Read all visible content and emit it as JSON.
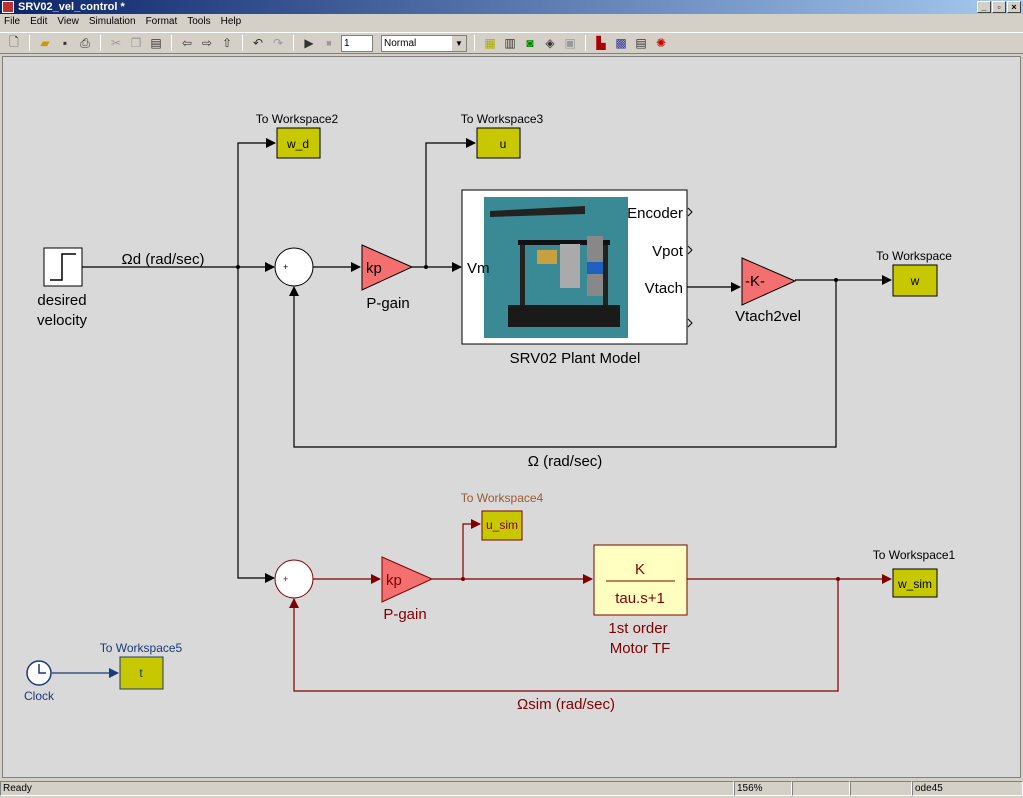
{
  "window": {
    "title": "SRV02_vel_control *",
    "min": "_",
    "max": "▫",
    "close": "×"
  },
  "menu": [
    "File",
    "Edit",
    "View",
    "Simulation",
    "Format",
    "Tools",
    "Help"
  ],
  "toolbar": {
    "stop_time": "1",
    "sim_mode": "Normal"
  },
  "status": {
    "left": "Ready",
    "zoom": "156%",
    "blank1": "",
    "blank2": "",
    "solver": "ode45"
  },
  "colors": {
    "canvas": "#d9d9d9",
    "gain": "#f47070",
    "workspace": "#c8c800",
    "sim_signal": "#800000",
    "clock": "#1a3a7a"
  },
  "diagram": {
    "step": {
      "label1": "desired",
      "label2": "velocity"
    },
    "ref_signal": "Ωd (rad/sec)",
    "gain1": {
      "value": "kp",
      "label": "P-gain"
    },
    "plant": {
      "label": "SRV02 Plant Model",
      "in": "Vm",
      "out1": "Encoder",
      "out2": "Vpot",
      "out3": "Vtach"
    },
    "gain2": {
      "value": "-K-",
      "label": "Vtach2vel"
    },
    "feedback": "Ω (rad/sec)",
    "ws": [
      {
        "title": "To Workspace2",
        "var": "w_d"
      },
      {
        "title": "To Workspace3",
        "var": "u"
      },
      {
        "title": "To Workspace",
        "var": "w"
      },
      {
        "title": "To Workspace4",
        "var": "u_sim"
      },
      {
        "title": "To Workspace1",
        "var": "w_sim"
      },
      {
        "title": "To Workspace5",
        "var": "t"
      }
    ],
    "gain3": {
      "value": "kp",
      "label": "P-gain"
    },
    "tf": {
      "num": "K",
      "den": "tau.s+1",
      "label1": "1st order",
      "label2": "Motor TF"
    },
    "sim_feedback": "Ωsim (rad/sec)",
    "clock": "Clock",
    "sum_plus": "+",
    "sum_minus": "_"
  }
}
